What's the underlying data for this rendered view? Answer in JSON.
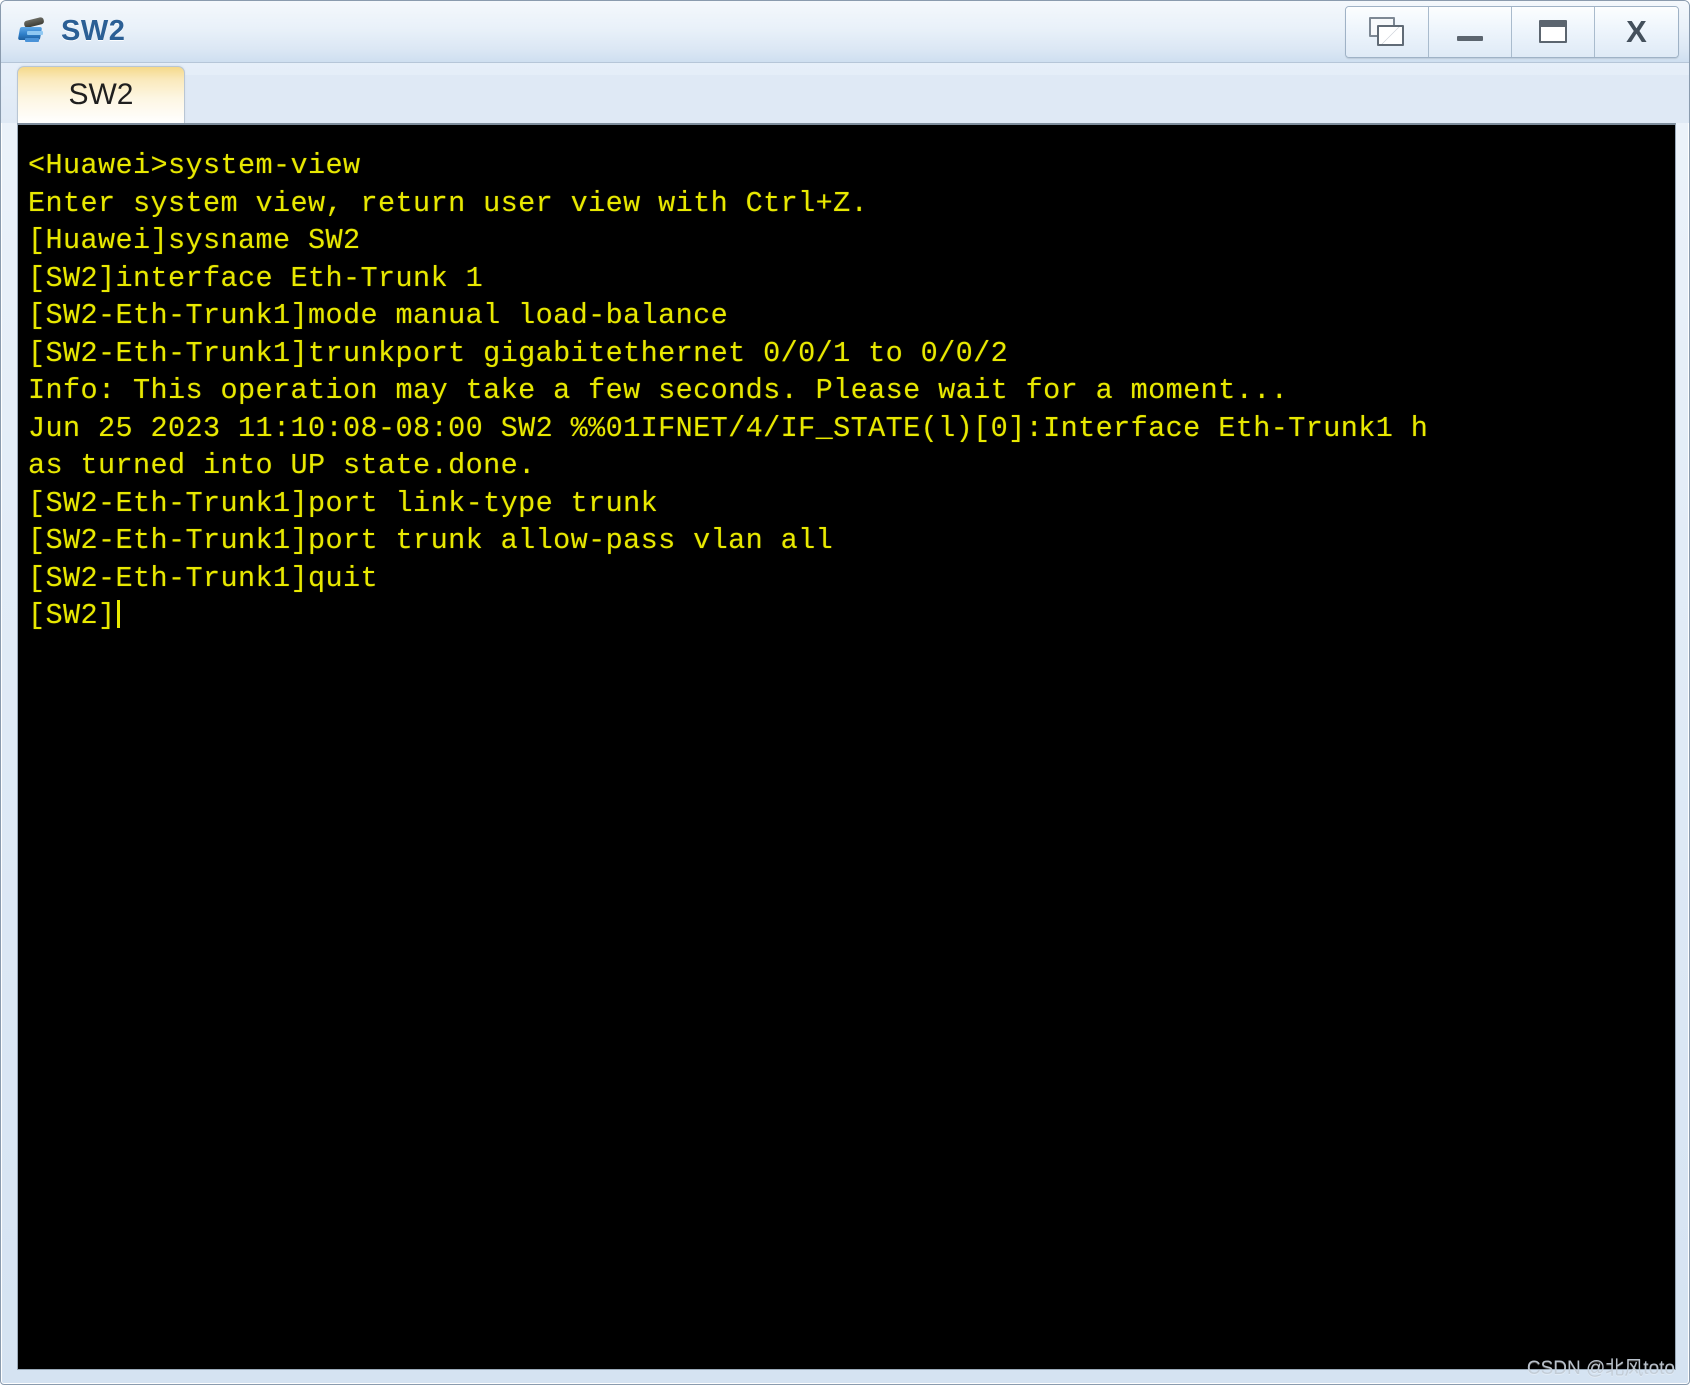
{
  "window": {
    "title": "SW2",
    "icon": "switch-icon",
    "controls": [
      {
        "name": "restore-button",
        "icon": "restore-window-icon",
        "label": ""
      },
      {
        "name": "minimize-button",
        "icon": "minimize-icon",
        "label": ""
      },
      {
        "name": "maximize-button",
        "icon": "maximize-icon",
        "label": ""
      },
      {
        "name": "close-button",
        "icon": "close-icon",
        "label": "X"
      }
    ]
  },
  "tabs": [
    {
      "label": "SW2",
      "active": true
    }
  ],
  "terminal": {
    "background_color": "#000000",
    "text_color": "#e8e800",
    "lines": [
      "<Huawei>system-view",
      "Enter system view, return user view with Ctrl+Z.",
      "[Huawei]sysname SW2",
      "[SW2]interface Eth-Trunk 1",
      "[SW2-Eth-Trunk1]mode manual load-balance",
      "[SW2-Eth-Trunk1]trunkport gigabitethernet 0/0/1 to 0/0/2",
      "Info: This operation may take a few seconds. Please wait for a moment...",
      "Jun 25 2023 11:10:08-08:00 SW2 %%01IFNET/4/IF_STATE(l)[0]:Interface Eth-Trunk1 h",
      "as turned into UP state.done.",
      "[SW2-Eth-Trunk1]port link-type trunk",
      "[SW2-Eth-Trunk1]port trunk allow-pass vlan all",
      "[SW2-Eth-Trunk1]quit",
      "[SW2]"
    ],
    "prompt_cursor": true
  },
  "watermark": {
    "text": "CSDN @北风toto"
  }
}
